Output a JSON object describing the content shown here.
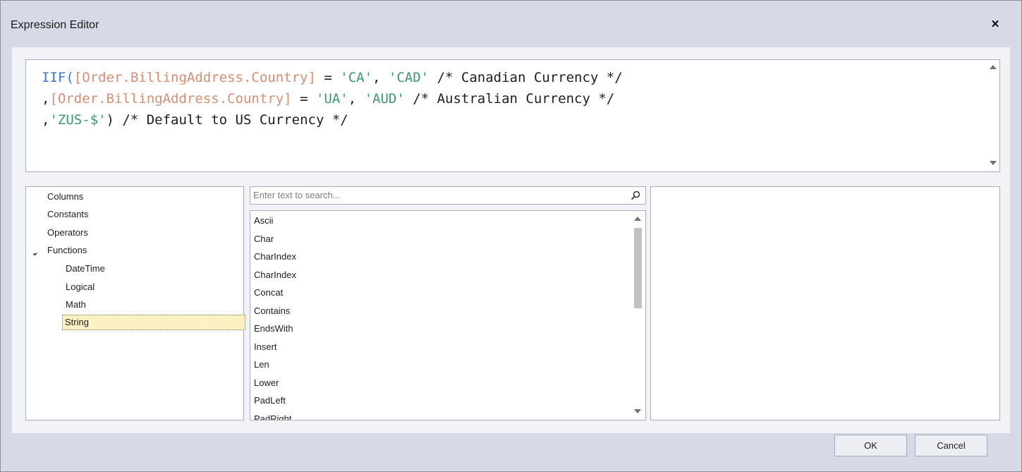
{
  "window": {
    "title": "Expression Editor",
    "close_label": "×"
  },
  "editor": {
    "lines": [
      [
        {
          "t": "IIF(",
          "c": "kw"
        },
        {
          "t": "[Order.BillingAddress.Country]",
          "c": "fld"
        },
        {
          "t": " = ",
          "c": "cmt"
        },
        {
          "t": "'CA'",
          "c": "str"
        },
        {
          "t": ", ",
          "c": "cmt"
        },
        {
          "t": "'CAD'",
          "c": "str"
        },
        {
          "t": " /* Canadian Currency */",
          "c": "cmt"
        }
      ],
      [
        {
          "t": ",",
          "c": "cmt"
        },
        {
          "t": "[Order.BillingAddress.Country]",
          "c": "fld"
        },
        {
          "t": " = ",
          "c": "cmt"
        },
        {
          "t": "'UA'",
          "c": "str"
        },
        {
          "t": ", ",
          "c": "cmt"
        },
        {
          "t": "'AUD'",
          "c": "str"
        },
        {
          "t": " /* Australian Currency */",
          "c": "cmt"
        }
      ],
      [
        {
          "t": ",",
          "c": "cmt"
        },
        {
          "t": "'ZUS-$'",
          "c": "str"
        },
        {
          "t": ") /* Default to US Currency */",
          "c": "cmt"
        }
      ]
    ]
  },
  "tree": {
    "items": [
      "Columns",
      "Constants",
      "Operators",
      "Functions"
    ],
    "functions_children": [
      "DateTime",
      "Logical",
      "Math",
      "String"
    ],
    "selected": "String"
  },
  "search": {
    "placeholder": "Enter text to search...",
    "value": ""
  },
  "functions_list": [
    "Ascii",
    "Char",
    "CharIndex",
    "CharIndex",
    "Concat",
    "Contains",
    "EndsWith",
    "Insert",
    "Len",
    "Lower",
    "PadLeft",
    "PadRight"
  ],
  "footer": {
    "ok_label": "OK",
    "cancel_label": "Cancel"
  },
  "colors": {
    "keyword": "#3b78c8",
    "field": "#d98e73",
    "string": "#3a9a6a",
    "selection": "#fbf1c3"
  },
  "icons": {
    "close": "close-icon",
    "search": "search-icon",
    "expander": "expanded-triangle-icon"
  }
}
